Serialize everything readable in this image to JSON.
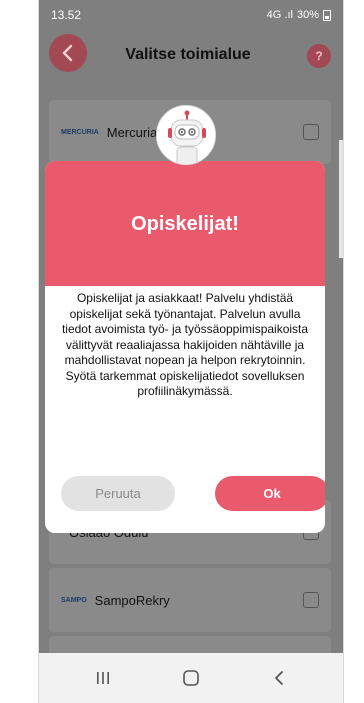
{
  "status": {
    "time": "13.52",
    "signal": "4G .ıl",
    "battery": "30%"
  },
  "header": {
    "title": "Valitse toimialue",
    "help_label": "?"
  },
  "list": [
    {
      "logo": "MERCURIA",
      "name": "MercuriaVTS"
    },
    {
      "logo": "",
      "name": "Osiaao Odulu"
    },
    {
      "logo": "SAMPO",
      "name": "SampoRekry"
    }
  ],
  "modal": {
    "title": "Opiskelijat!",
    "body": "Opiskelijat ja asiakkaat! Palvelu yhdistää opiskelijat sekä työnantajat. Palvelun avulla tiedot avoimista työ- ja työssäoppimispaikoista välittyvät reaaliajassa hakijoiden nähtäville ja mahdollistavat nopean ja helpon rekrytoinnin. Syötä tarkemmat opiskelijatiedot sovelluksen profiilinäkymässä.",
    "cancel_label": "Peruuta",
    "ok_label": "Ok"
  },
  "colors": {
    "accent": "#e85a6c",
    "dim_accent": "#a24953"
  }
}
